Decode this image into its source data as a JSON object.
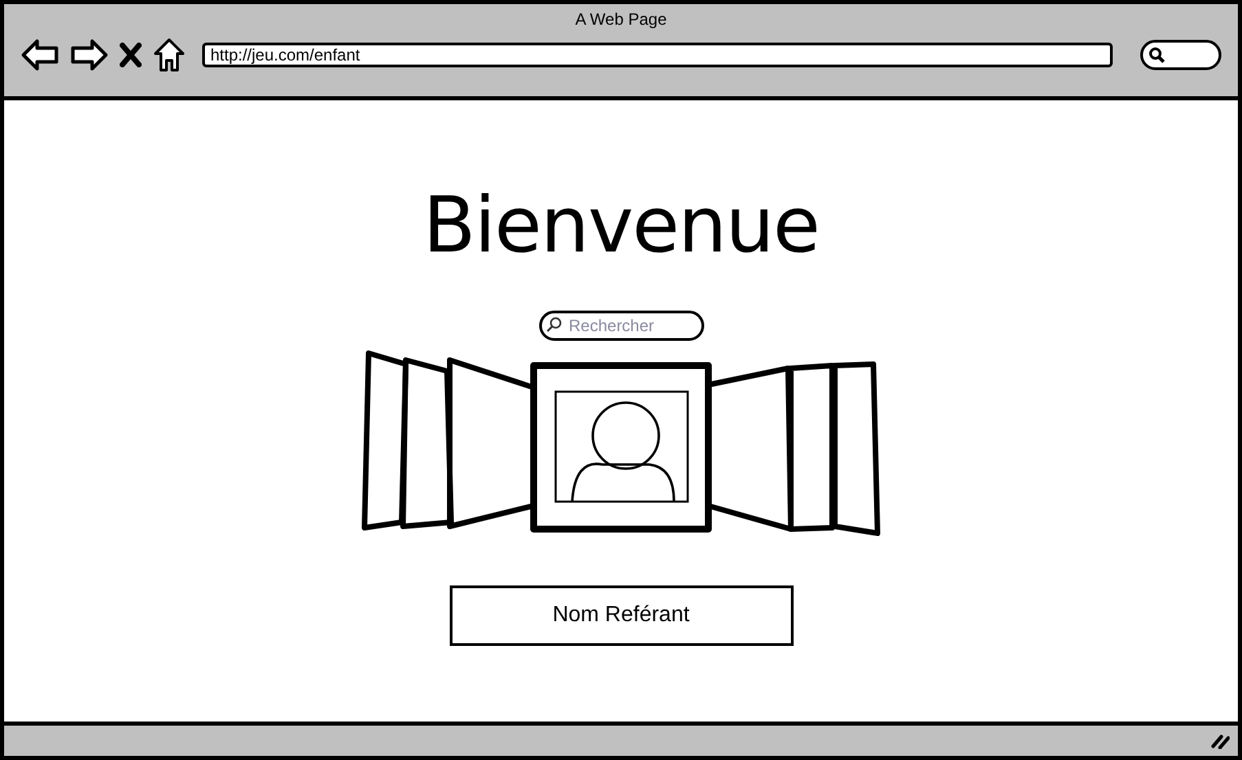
{
  "window": {
    "title": "A Web Page"
  },
  "address_bar": {
    "value": "http://jeu.com/enfant"
  },
  "heading": "Bienvenue",
  "search": {
    "placeholder": "Rechercher"
  },
  "button": {
    "label": "Nom Reférant"
  }
}
